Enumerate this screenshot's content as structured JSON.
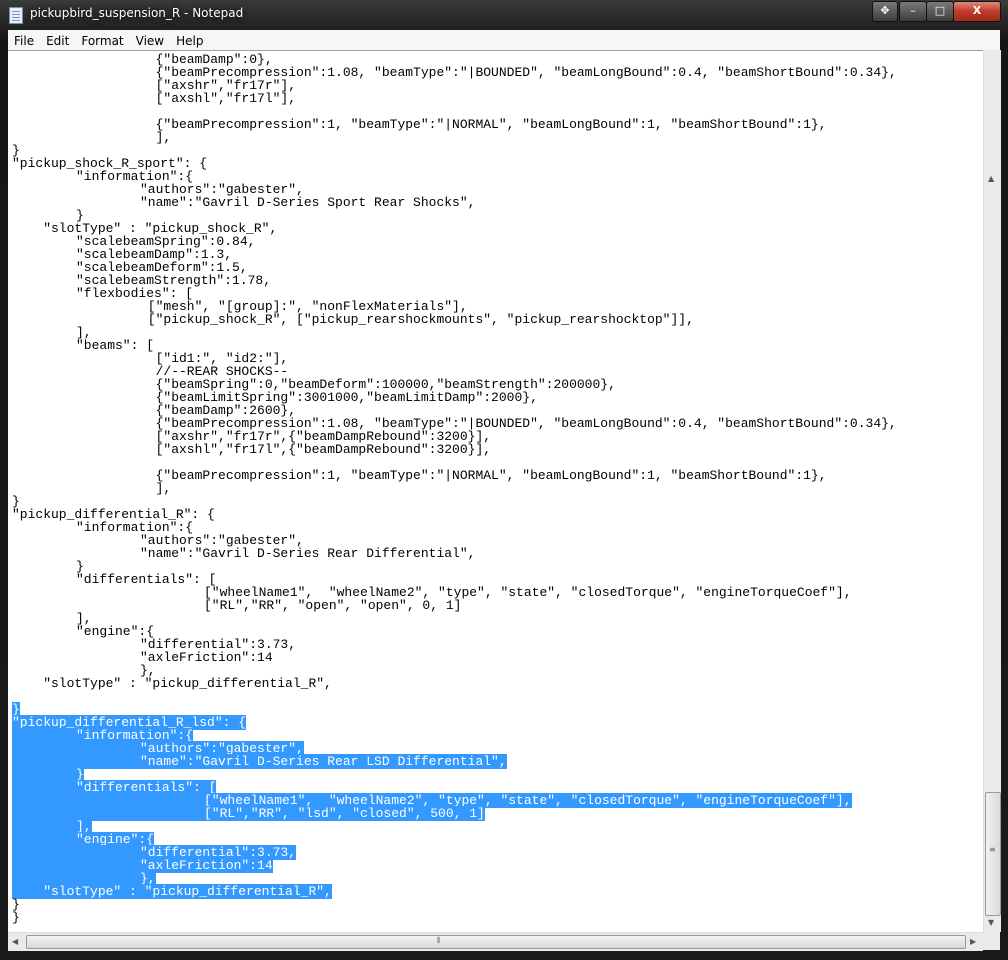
{
  "window": {
    "title": "pickupbird_suspension_R - Notepad",
    "minimize": "–",
    "maximize": "□",
    "close": "X",
    "move": "✥"
  },
  "menu": [
    "File",
    "Edit",
    "Format",
    "View",
    "Help"
  ],
  "colors": {
    "selection": "#3399ff"
  },
  "lines_before": [
    "\t\t  {\"beamDamp\":0},",
    "\t\t  {\"beamPrecompression\":1.08, \"beamType\":\"|BOUNDED\", \"beamLongBound\":0.4, \"beamShortBound\":0.34},",
    "\t\t  [\"axshr\",\"fr17r\"],",
    "\t\t  [\"axshl\",\"fr17l\"],",
    "",
    "\t\t  {\"beamPrecompression\":1, \"beamType\":\"|NORMAL\", \"beamLongBound\":1, \"beamShortBound\":1},",
    "\t\t  ],",
    "}",
    "\"pickup_shock_R_sport\": {",
    "\t\"information\":{",
    "\t\t\"authors\":\"gabester\",",
    "\t\t\"name\":\"Gavril D-Series Sport Rear Shocks\",",
    "\t}",
    "    \"slotType\" : \"pickup_shock_R\",",
    "\t\"scalebeamSpring\":0.84,",
    "\t\"scalebeamDamp\":1.3,",
    "\t\"scalebeamDeform\":1.5,",
    "\t\"scalebeamStrength\":1.78,",
    "\t\"flexbodies\": [",
    "\t\t [\"mesh\", \"[group]:\", \"nonFlexMaterials\"],",
    "\t\t [\"pickup_shock_R\", [\"pickup_rearshockmounts\", \"pickup_rearshocktop\"]],",
    "\t],",
    "\t\"beams\": [",
    "\t\t  [\"id1:\", \"id2:\"],",
    "\t\t  //--REAR SHOCKS--",
    "\t\t  {\"beamSpring\":0,\"beamDeform\":100000,\"beamStrength\":200000},",
    "\t\t  {\"beamLimitSpring\":3001000,\"beamLimitDamp\":2000},",
    "\t\t  {\"beamDamp\":2600},",
    "\t\t  {\"beamPrecompression\":1.08, \"beamType\":\"|BOUNDED\", \"beamLongBound\":0.4, \"beamShortBound\":0.34},",
    "\t\t  [\"axshr\",\"fr17r\",{\"beamDampRebound\":3200}],",
    "\t\t  [\"axshl\",\"fr17l\",{\"beamDampRebound\":3200}],",
    "",
    "\t\t  {\"beamPrecompression\":1, \"beamType\":\"|NORMAL\", \"beamLongBound\":1, \"beamShortBound\":1},",
    "\t\t  ],",
    "}",
    "\"pickup_differential_R\": {",
    "\t\"information\":{",
    "\t\t\"authors\":\"gabester\",",
    "\t\t\"name\":\"Gavril D-Series Rear Differential\",",
    "\t}",
    "\t\"differentials\": [",
    "\t\t\t[\"wheelName1\",  \"wheelName2\", \"type\", \"state\", \"closedTorque\", \"engineTorqueCoef\"],",
    "\t\t\t[\"RL\",\"RR\", \"open\", \"open\", 0, 1]",
    "\t],",
    "\t\"engine\":{",
    "\t\t\"differential\":3.73,",
    "\t\t\"axleFriction\":14",
    "\t\t},",
    "    \"slotType\" : \"pickup_differential_R\",",
    ""
  ],
  "lines_selected": [
    "}",
    "\"pickup_differential_R_lsd\": {",
    "\t\"information\":{",
    "\t\t\"authors\":\"gabester\",",
    "\t\t\"name\":\"Gavril D-Series Rear LSD Differential\",",
    "\t}",
    "\t\"differentials\": [",
    "\t\t\t[\"wheelName1\",  \"wheelName2\", \"type\", \"state\", \"closedTorque\", \"engineTorqueCoef\"],",
    "\t\t\t[\"RL\",\"RR\", \"lsd\", \"closed\", 500, 1]",
    "\t],",
    "\t\"engine\":{",
    "\t\t\"differential\":3.73,",
    "\t\t\"axleFriction\":14",
    "\t\t},",
    "    \"slotType\" : \"pickup_differential_R\","
  ],
  "lines_after": [
    "}",
    "}"
  ]
}
